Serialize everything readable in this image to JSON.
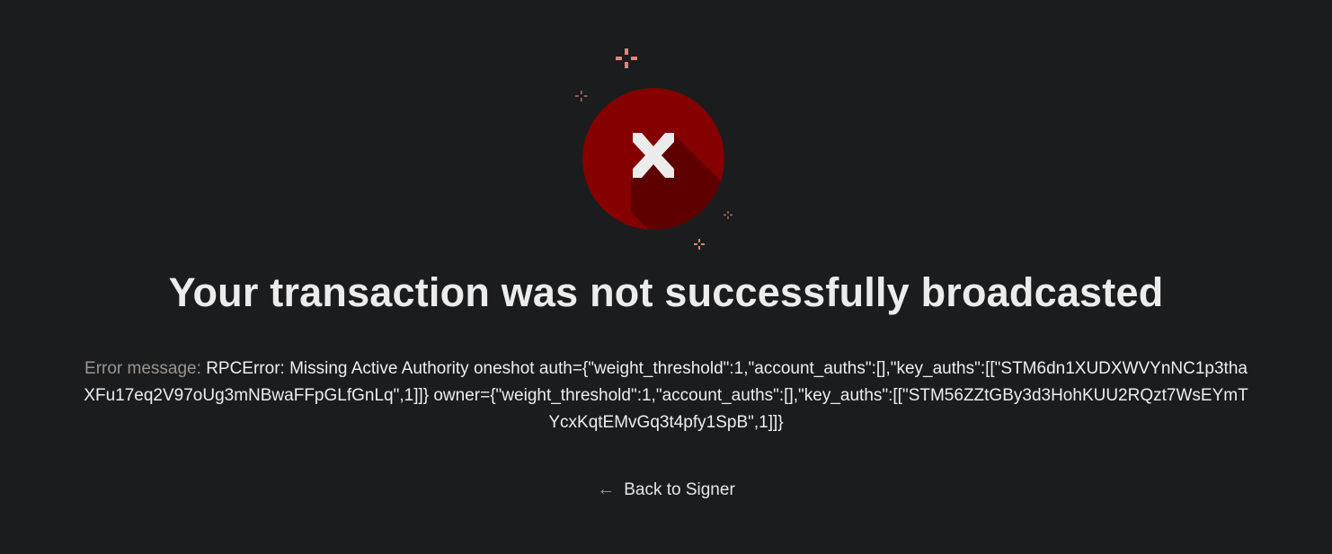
{
  "status": {
    "icon": "error-x-icon",
    "accent_color": "#8b0000",
    "title": "Your transaction was not successfully broadcasted"
  },
  "error": {
    "label": "Error message:",
    "message": "RPCError: Missing Active Authority oneshot auth={\"weight_threshold\":1,\"account_auths\":[],\"key_auths\":[[\"STM6dn1XUDXWVYnNC1p3thaXFu17eq2V97oUg3mNBwaFFpGLfGnLq\",1]]} owner={\"weight_threshold\":1,\"account_auths\":[],\"key_auths\":[[\"STM56ZZtGBy3d3HohKUU2RQzt7WsEYmTYcxKqtEMvGq3t4pfy1SpB\",1]]}"
  },
  "navigation": {
    "back_icon": "arrow-left-icon",
    "back_arrow": "←",
    "back_label": "Back to Signer"
  }
}
